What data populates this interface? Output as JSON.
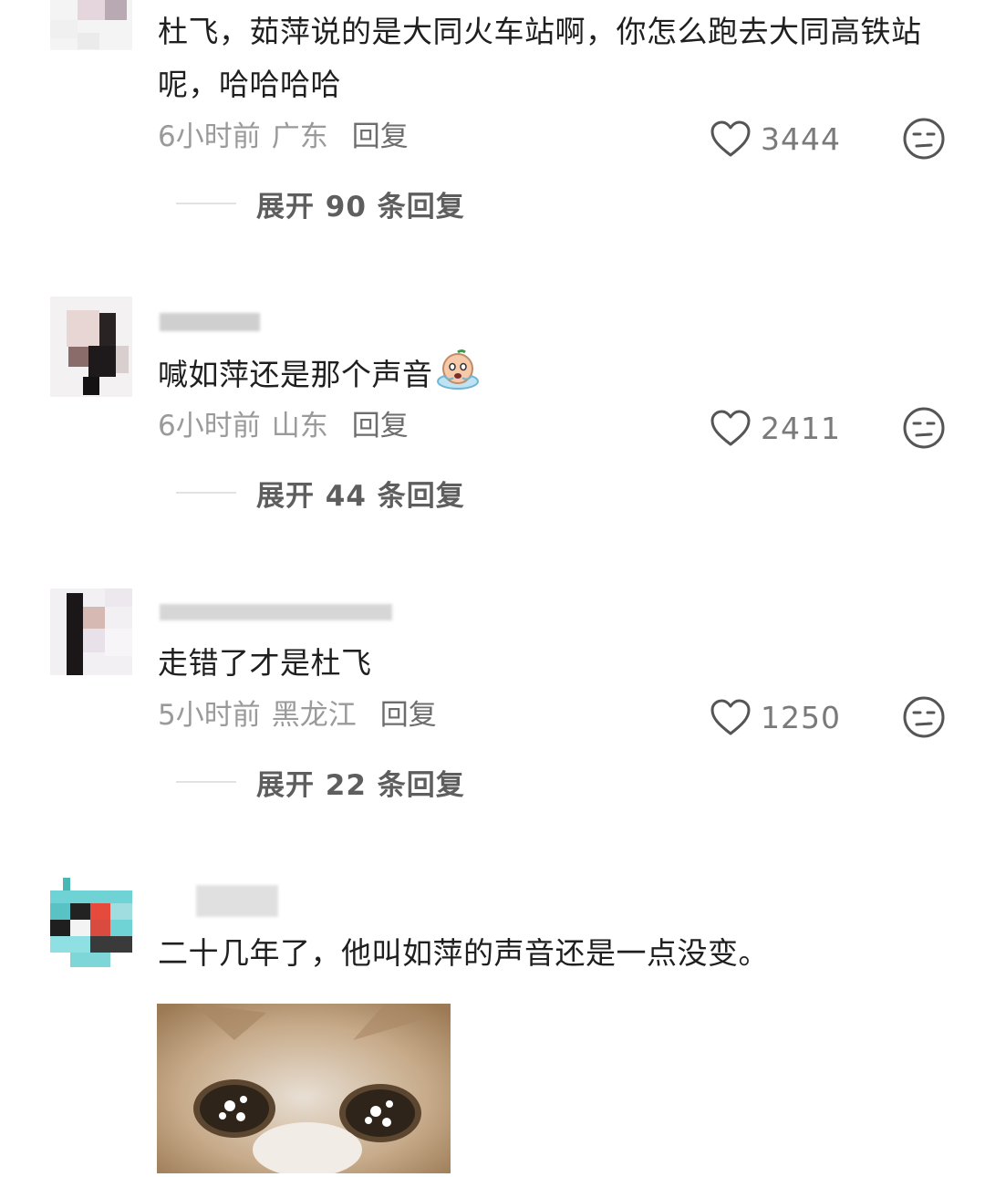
{
  "comments": [
    {
      "username": "",
      "text": "杜飞，茹萍说的是大同火车站啊，你怎么跑去大同高铁站呢，哈哈哈哈",
      "time": "6小时前",
      "location": "广东",
      "reply_label": "回复",
      "likes": "3444",
      "expand_label": "展开 90 条回复"
    },
    {
      "username": "",
      "text": "喊如萍还是那个声音",
      "time": "6小时前",
      "location": "山东",
      "reply_label": "回复",
      "likes": "2411",
      "expand_label": "展开 44 条回复"
    },
    {
      "username": "",
      "text": "走错了才是杜飞",
      "time": "5小时前",
      "location": "黑龙江",
      "reply_label": "回复",
      "likes": "1250",
      "expand_label": "展开 22 条回复"
    },
    {
      "username": "",
      "text": "二十几年了，他叫如萍的声音还是一点没变。"
    }
  ],
  "icons": {
    "like": "heart-outline-icon",
    "dislike": "meh-face-icon",
    "emoji": "crying-face-emoji-icon"
  },
  "colors": {
    "text": "#1f1f1f",
    "meta": "#9a9a9a",
    "icon": "#555555"
  }
}
